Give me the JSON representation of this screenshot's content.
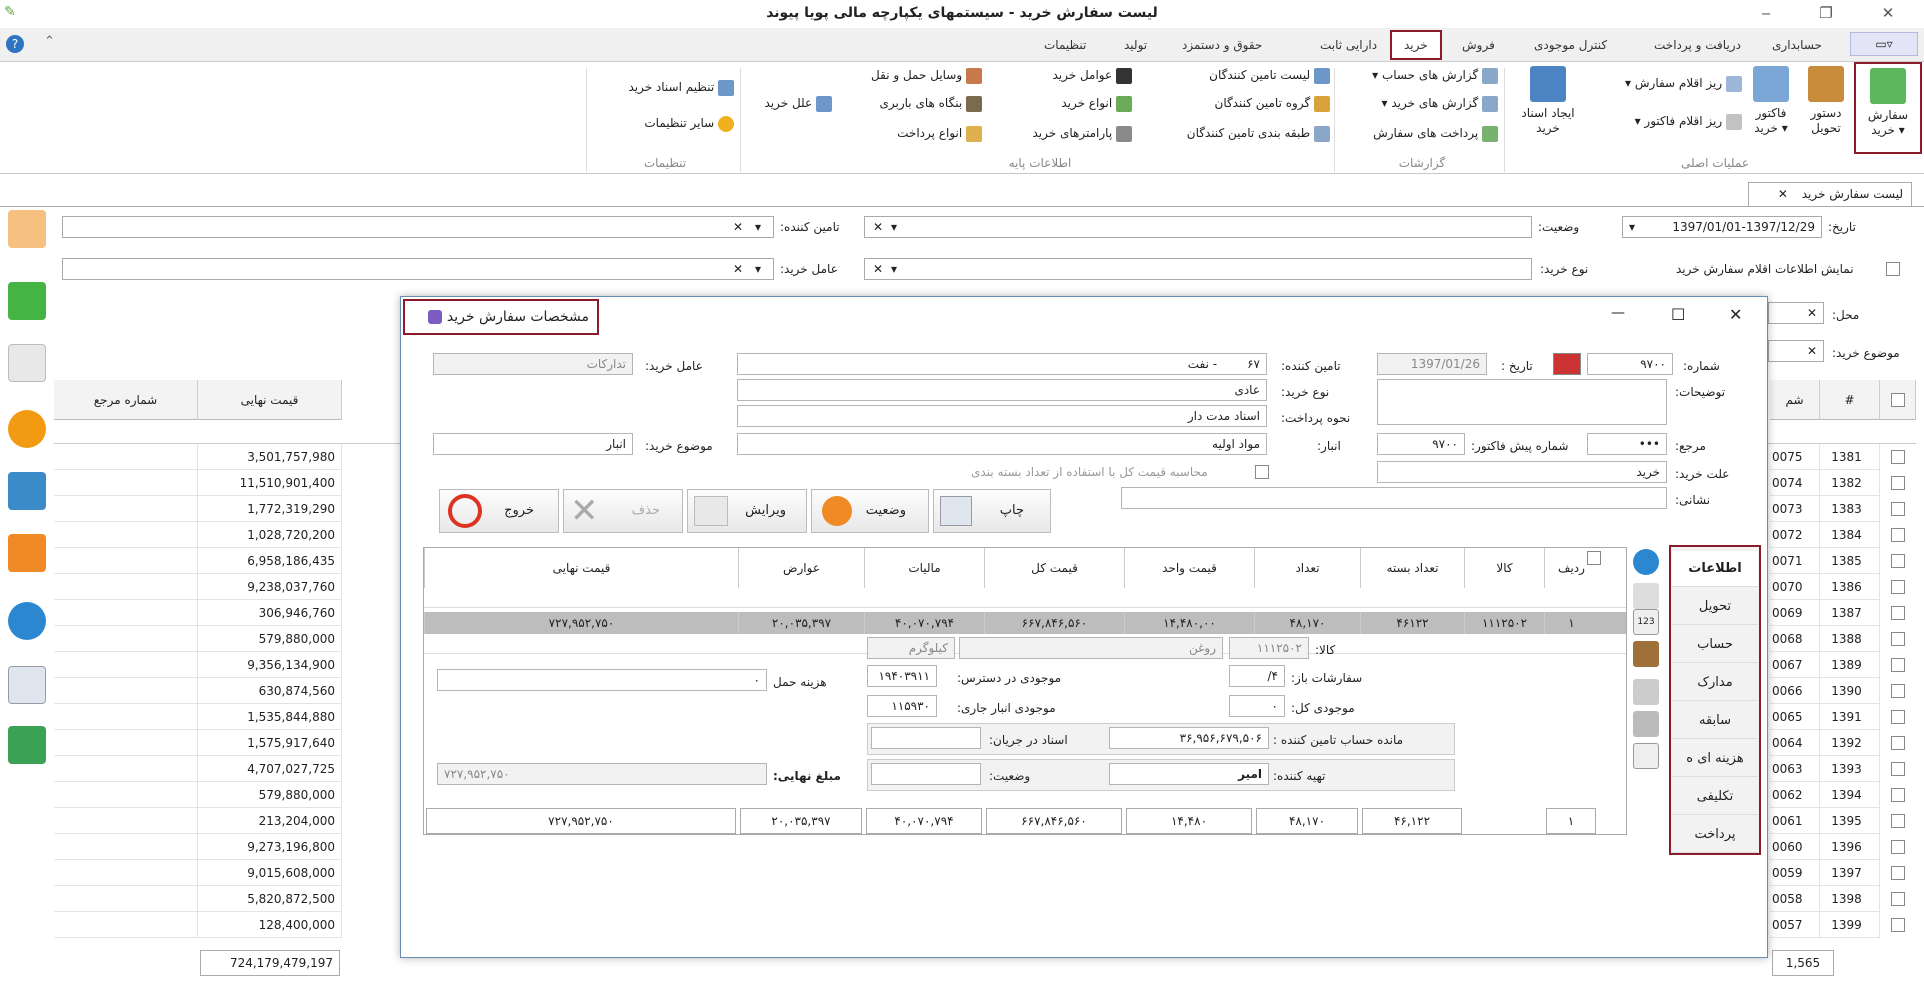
{
  "window": {
    "title": "لیست سفارش خرید - سیستمهای یکپارچه مالی پویا پیوند",
    "minimize": "‒",
    "restore": "❐",
    "close": "✕",
    "menu_glyph": "▭▿",
    "app_icon": "✎"
  },
  "ribbon_tabs": [
    "حسابداری",
    "دریافت و پرداخت",
    "کنترل موجودی",
    "فروش",
    "خرید",
    "دارایی ثابت",
    "حقوق و دستمزد",
    "تولید",
    "تنظیمات"
  ],
  "ribbon_active": "خرید",
  "groups": {
    "main": "عملیات اصلی",
    "reports": "گزارشات",
    "basic": "اطلاعات پایه",
    "settings": "تنظیمات"
  },
  "main_ops": {
    "order": "سفارش خرید",
    "delivery": "دستور تحویل",
    "invoice": "فاکتور خرید",
    "order_items": "ریز اقلام سفارش",
    "invoice_items": "ریز اقلام فاکتور",
    "create_doc": "ایجاد اسناد خرید"
  },
  "reports": {
    "account": "گزارش های حساب",
    "purchase": "گزارش های خرید",
    "payments": "پرداخت های سفارش"
  },
  "basic": {
    "suppliers": "لیست تامین کنندگان",
    "supplier_group": "گروه تامین کنندگان",
    "supplier_class": "طبقه بندی تامین کنندگان",
    "agents": "عوامل خرید",
    "types": "انواع خرید",
    "params": "پارامترهای خرید",
    "transport": "وسایل حمل و نقل",
    "freight": "بنگاه های باربری",
    "payment_types": "انواع پرداخت",
    "reasons": "علل خرید"
  },
  "settings": {
    "doc_settings": "تنظیم اسناد خرید",
    "other": "سایر تنظیمات"
  },
  "doc_tab": {
    "label": "لیست سفارش خرید",
    "close": "✕"
  },
  "filters": {
    "date_label": "تاریخ:",
    "date_value": "1397/01/01-1397/12/29",
    "status_label": "وضعیت:",
    "supplier_label": "تامین کننده:",
    "show_items_label": "نمایش اطلاعات اقلام سفارش خرید",
    "type_label": "نوع خرید:",
    "agent_label": "عامل خرید:",
    "location_label": "محل:",
    "subject_label": "موضوع خرید:",
    "x": "✕",
    "arrow": "▾"
  },
  "grid": {
    "headers": {
      "num": "#",
      "serial": "شم",
      "final": "قیمت نهایی",
      "ref": "شماره مرجع"
    },
    "rows": [
      [
        "1381",
        "0075",
        "3,501,757,980"
      ],
      [
        "1382",
        "0074",
        "11,510,901,400"
      ],
      [
        "1383",
        "0073",
        "1,772,319,290"
      ],
      [
        "1384",
        "0072",
        "1,028,720,200"
      ],
      [
        "1385",
        "0071",
        "6,958,186,435"
      ],
      [
        "1386",
        "0070",
        "9,238,037,760"
      ],
      [
        "1387",
        "0069",
        "306,946,760"
      ],
      [
        "1388",
        "0068",
        "579,880,000"
      ],
      [
        "1389",
        "0067",
        "9,356,134,900"
      ],
      [
        "1390",
        "0066",
        "630,874,560"
      ],
      [
        "1391",
        "0065",
        "1,535,844,880"
      ],
      [
        "1392",
        "0064",
        "1,575,917,640"
      ],
      [
        "1393",
        "0063",
        "4,707,027,725"
      ],
      [
        "1394",
        "0062",
        "579,880,000"
      ],
      [
        "1395",
        "0061",
        "213,204,000"
      ],
      [
        "1396",
        "0060",
        "9,273,196,800"
      ],
      [
        "1397",
        "0059",
        "9,015,608,000"
      ],
      [
        "1398",
        "0058",
        "5,820,872,500"
      ],
      [
        "1399",
        "0057",
        "128,400,000"
      ]
    ],
    "footer_count": "1,565",
    "footer_total": "724,179,479,197"
  },
  "dialog": {
    "title": "مشخصات سفارش خرید",
    "number_label": "شماره:",
    "number": "۹۷۰۰",
    "date_label": "تاریخ :",
    "date": "1397/01/26",
    "supplier_label": "تامین کننده:",
    "supplier_code": "۶۷",
    "supplier_name": "- نفت",
    "agent_label": "عامل خرید:",
    "agent": "تدارکات",
    "desc_label": "توضیحات:",
    "type_label": "نوع خرید:",
    "type": "عادی",
    "payment_label": "نحوه پرداخت:",
    "payment": "اسناد مدت دار",
    "ref_label": "مرجع:",
    "ref": "•••",
    "proforma_label": "شماره پیش فاکتور:",
    "proforma": "۹۷۰۰",
    "store_label": "انبار:",
    "store": "مواد اولیه",
    "subject_label": "موضوع خرید:",
    "subject": "انبار",
    "reason_label": "علت خرید:",
    "reason": "خرید",
    "calc_label": "محاسبه قیمت کل با استفاده از تعداد بسته بندی",
    "address_label": "نشانی:",
    "buttons": {
      "print": "چاپ",
      "status": "وضعیت",
      "edit": "ویرایش",
      "delete": "حذف",
      "exit": "خروج"
    },
    "vtabs": [
      "اطلاعات",
      "تحویل",
      "حساب",
      "مدارک",
      "سابقه",
      "هزینه ای ه",
      "تکلیفی",
      "پرداخت"
    ],
    "items": {
      "headers": [
        "ردیف",
        "کالا",
        "تعداد بسته",
        "تعداد",
        "قیمت واحد",
        "قیمت کل",
        "مالیات",
        "عوارض",
        "قیمت نهایی"
      ],
      "row": [
        "۱",
        "۱۱۱۲۵۰۲",
        "۴۶۱۲۲",
        "۴۸,۱۷۰",
        "۱۴,۴۸۰,۰۰",
        "۶۶۷,۸۴۶,۵۶۰",
        "۴۰,۰۷۰,۷۹۴",
        "۲۰,۰۳۵,۳۹۷",
        "۷۲۷,۹۵۲,۷۵۰"
      ],
      "totals": [
        "۱",
        "",
        "۴۶,۱۲۲",
        "۴۸,۱۷۰",
        "۱۴,۴۸۰",
        "۶۶۷,۸۴۶,۵۶۰",
        "۴۰,۰۷۰,۷۹۴",
        "۲۰,۰۳۵,۳۹۷",
        "۷۲۷,۹۵۲,۷۵۰"
      ]
    },
    "detail": {
      "item_label": "کالا:",
      "item_code": "۱۱۱۲۵۰۲",
      "item_name": "روغن",
      "unit": "کیلوگرم",
      "open_orders_label": "سفارشات باز:",
      "open_orders": "۴/",
      "available_label": "موجودی در دسترس:",
      "available": "۱۹۴۰۳۹۱۱",
      "total_stock_label": "موجودی کل:",
      "total_stock": "۰",
      "current_store_label": "موجودی انبار جاری:",
      "current_store": "۱۱۵۹۳۰",
      "shipping_label": "هزینه حمل",
      "shipping": "۰",
      "balance_label": "مانده حساب تامین کننده :",
      "balance": "۳۶,۹۵۶,۶۷۹,۵۰۶",
      "pending_label": "اسناد در جریان:",
      "preparer_label": "تهیه کننده:",
      "preparer": "امیر",
      "status_label": "وضعیت:",
      "final_label": "مبلغ نهایی:",
      "final": "۷۲۷,۹۵۲,۷۵۰"
    },
    "close": "✕",
    "maximize": "☐",
    "minimize": "—"
  }
}
